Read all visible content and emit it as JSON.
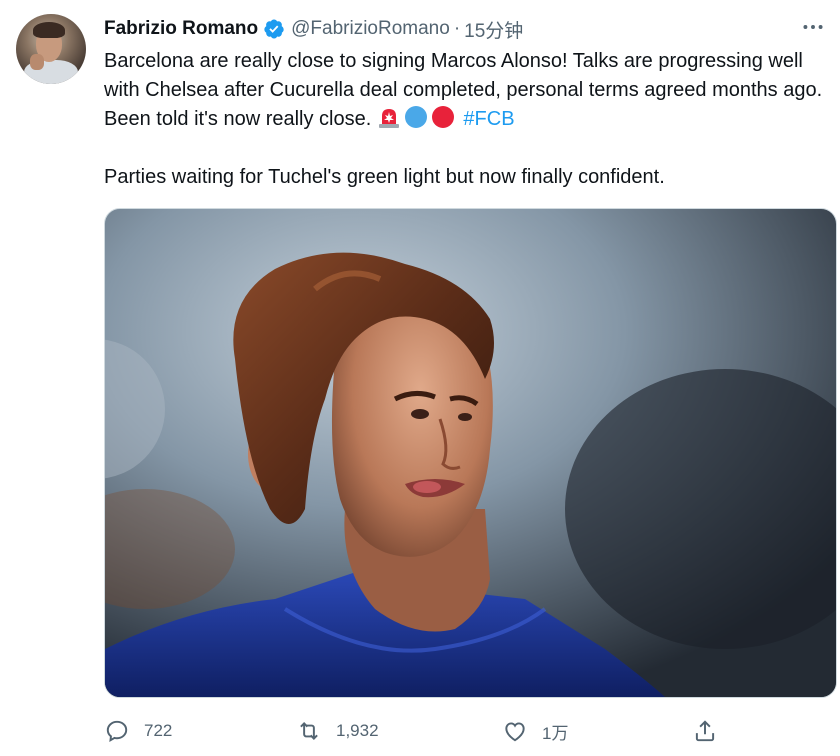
{
  "author": {
    "name": "Fabrizio Romano",
    "handle": "@FabrizioRomano",
    "separator": "·",
    "time": "15分钟"
  },
  "tweet": {
    "paragraph1": "Barcelona are really close to signing Marcos Alonso! Talks are progressing well with Chelsea after Cucurella deal completed, personal terms agreed months ago. Been told it's now really close.",
    "hashtag": "#FCB",
    "paragraph2": "Parties waiting for Tuchel's green light but now finally confident."
  },
  "actions": {
    "reply_count": "722",
    "retweet_count": "1,932",
    "like_count": "1万"
  },
  "icons": {
    "verified": "verified-badge-icon",
    "more": "more-horizontal-icon",
    "siren": "siren-emoji",
    "blue_circle": "blue-circle-emoji",
    "red_circle": "red-circle-emoji",
    "reply": "reply-icon",
    "retweet": "retweet-icon",
    "like": "heart-icon",
    "share": "share-icon"
  },
  "colors": {
    "accent": "#1d9bf0",
    "muted": "#536471",
    "text": "#0f1419",
    "blue_circle": "#4aa8e8",
    "red_circle": "#e8223a"
  }
}
